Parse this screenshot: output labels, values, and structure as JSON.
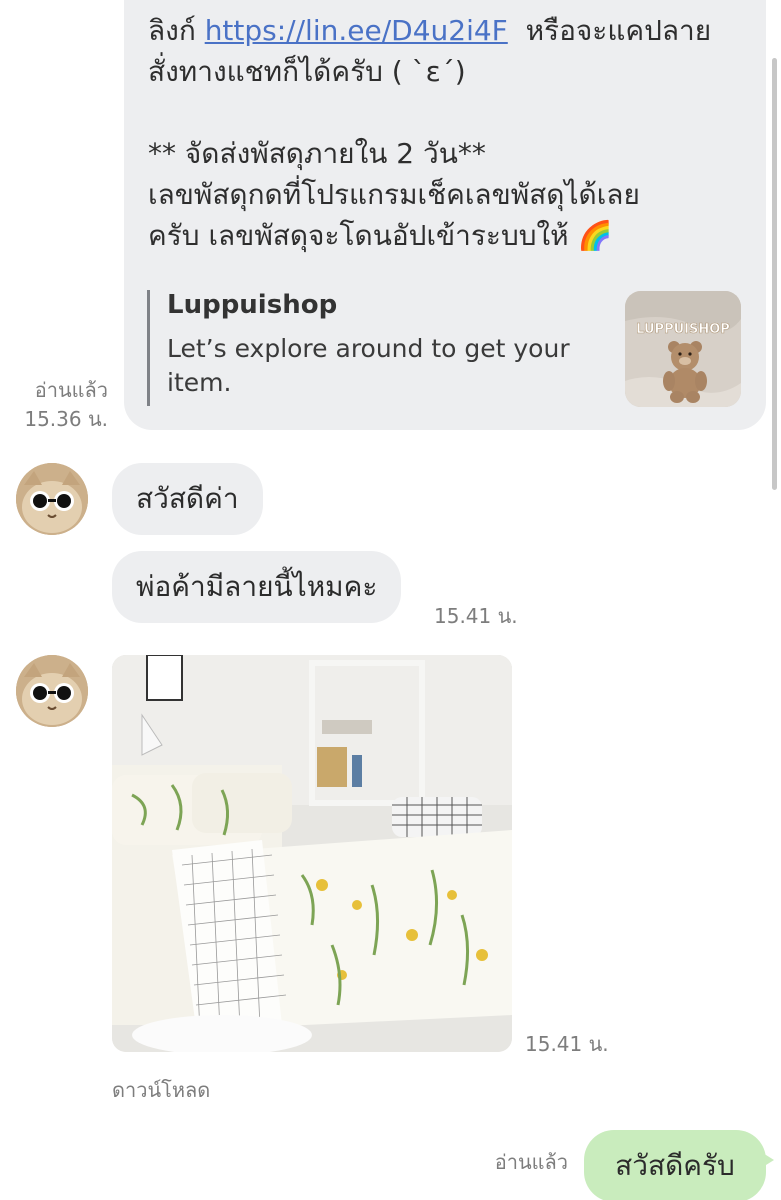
{
  "outgoing_card": {
    "line1_prefix": "ลิงก์ ",
    "link": "https://lin.ee/D4u2i4F",
    "line1_suffix": "  หรือจะแคปลาย",
    "line2": "สั่งทางแชทก็ได้ครับ ( `ε´)",
    "line3": "** จัดส่งพัสดุภายใน 2 วัน**",
    "line4": "เลขพัสดุกดที่โปรแกรมเช็คเลขพัสดุได้เลย",
    "line5": "ครับ เลขพัสดุจะโดนอัปเข้าระบบให้ 🌈",
    "preview": {
      "title": "Luppuishop",
      "description": "Let’s explore around to get your item.",
      "thumbnail_text": "LUPPUISHOP"
    },
    "read_status": "อ่านแล้ว",
    "time": "15.36 น."
  },
  "incoming": {
    "message1": "สวัสดีค่า",
    "message2": "พ่อค้ามีลายนี้ไหมคะ",
    "message2_time": "15.41 น.",
    "photo_time": "15.41 น.",
    "download_label": "ดาวน์โหลด"
  },
  "outgoing_last": {
    "read_status": "อ่านแล้ว",
    "text": "สวัสดีครับ"
  },
  "colors": {
    "incoming_bubble": "#edeef0",
    "outgoing_bubble": "#c9ecbd",
    "link": "#4a72c6",
    "meta_text": "#7d7d7d"
  }
}
